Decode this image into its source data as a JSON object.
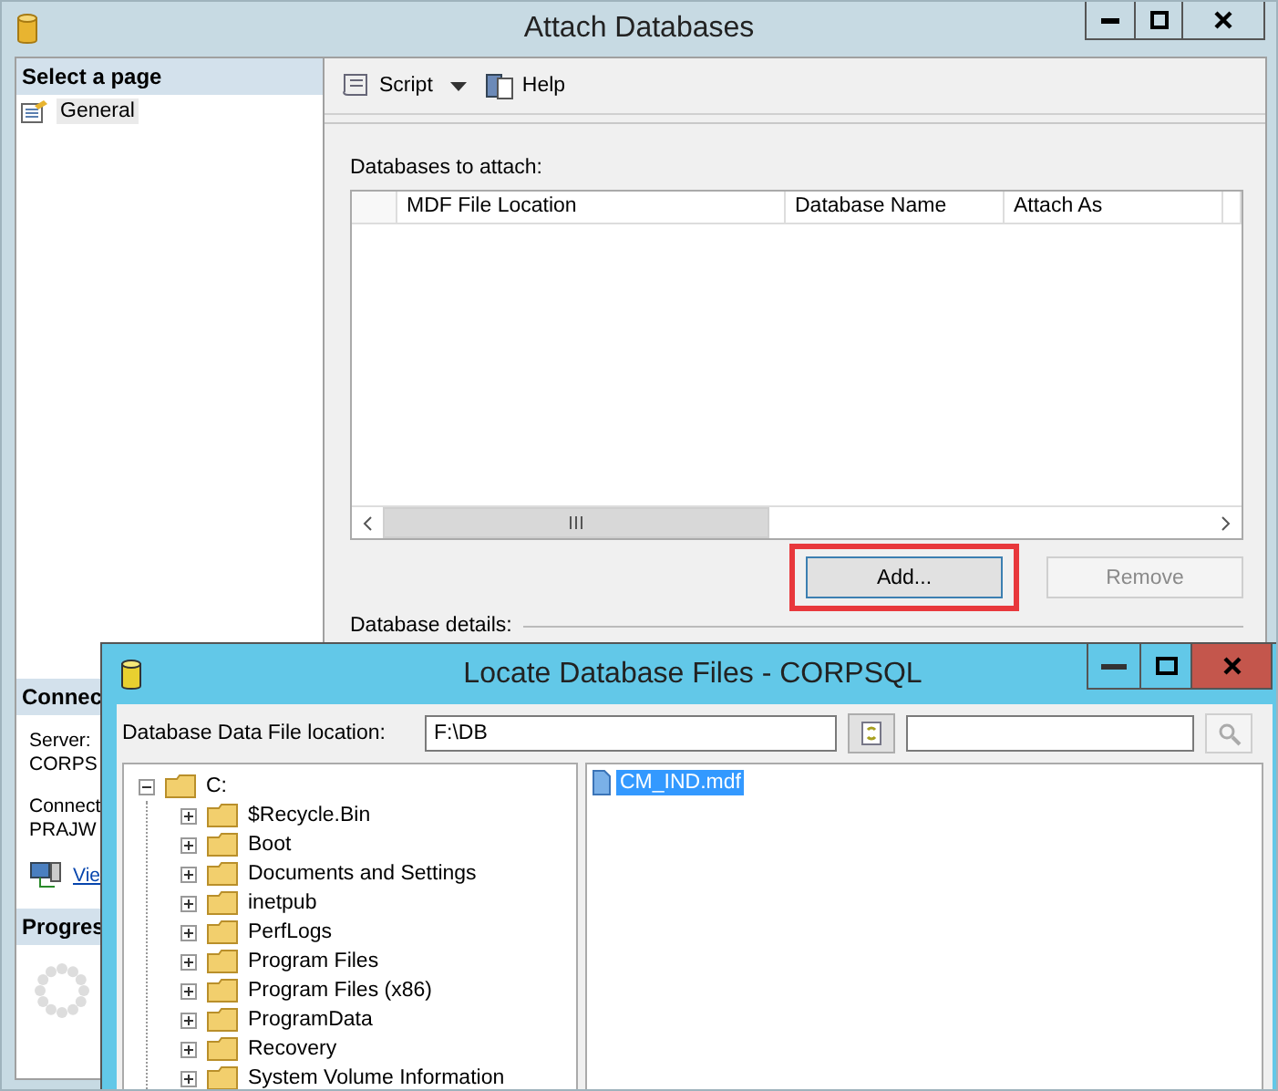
{
  "main_window": {
    "title": "Attach Databases"
  },
  "left_pane": {
    "header": "Select a page",
    "pages": [
      {
        "label": "General",
        "selected": true
      }
    ],
    "connection": {
      "header": "Connec",
      "lines": [
        "Server:",
        "CORPS",
        "Connect",
        "PRAJW"
      ],
      "link": "Vie"
    },
    "progress": {
      "header": "Progres"
    }
  },
  "toolbar": [
    {
      "label": "Script",
      "kind": "dropdown"
    },
    {
      "label": "Help",
      "kind": "button"
    }
  ],
  "attach": {
    "label": "Databases to attach:",
    "columns": [
      "MDF File Location",
      "Database Name",
      "Attach As"
    ],
    "buttons": [
      {
        "label": "Add...",
        "disabled": false,
        "highlighted": true
      },
      {
        "label": "Remove",
        "disabled": true,
        "highlighted": false
      }
    ]
  },
  "details": {
    "label": "Database details:"
  },
  "dialog": {
    "title": "Locate Database Files - CORPSQL",
    "location_label": "Database Data File location:",
    "location_value": "F:\\DB",
    "tree": [
      {
        "label": "C:",
        "expanded": true,
        "children": [
          {
            "label": "$Recycle.Bin",
            "expanded": false
          },
          {
            "label": "Boot",
            "expanded": false
          },
          {
            "label": "Documents and Settings",
            "expanded": false
          },
          {
            "label": "inetpub",
            "expanded": false
          },
          {
            "label": "PerfLogs",
            "expanded": false
          },
          {
            "label": "Program Files",
            "expanded": false
          },
          {
            "label": "Program Files (x86)",
            "expanded": false
          },
          {
            "label": "ProgramData",
            "expanded": false
          },
          {
            "label": "Recovery",
            "expanded": false
          },
          {
            "label": "System Volume Information",
            "expanded": false
          }
        ]
      }
    ],
    "files": [
      {
        "name": "CM_IND.mdf",
        "selected": true
      }
    ]
  }
}
